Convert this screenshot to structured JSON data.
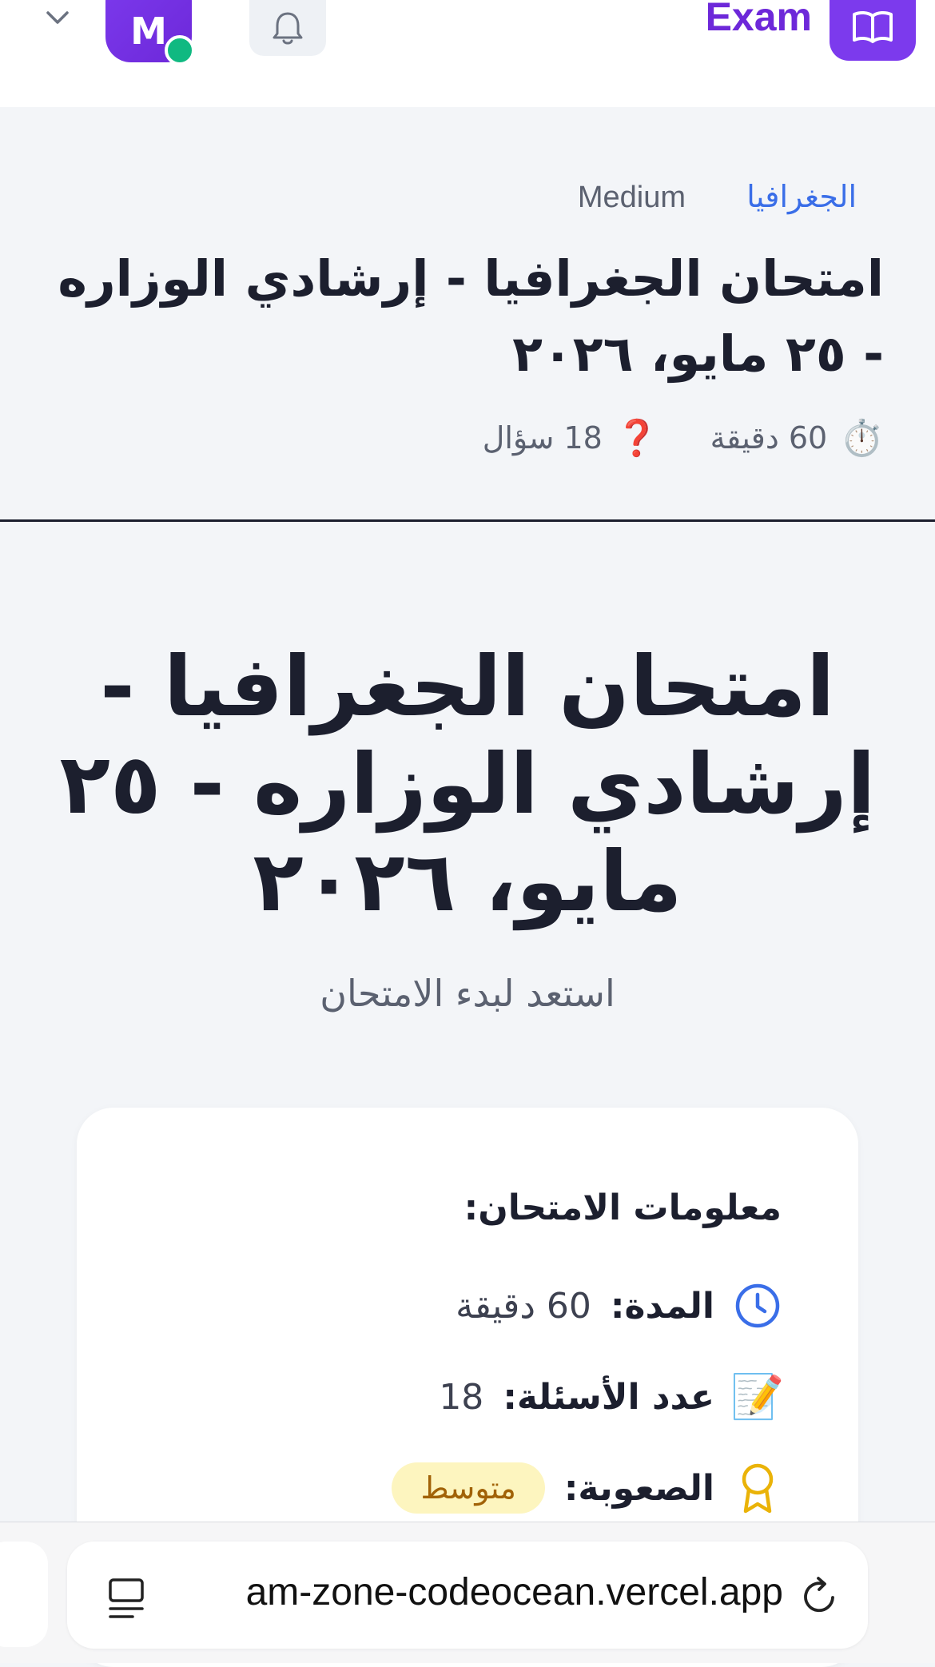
{
  "topbar": {
    "brand": "Exam",
    "avatar_initial": "M",
    "icons": [
      "chevron-down-icon",
      "bell-icon",
      "book-open-icon"
    ]
  },
  "exam_header": {
    "subject": "الجغرافيا",
    "level": "Medium",
    "title": "امتحان الجغرافيا - إرشادي الوزاره - ٢٥ مايو، ٢٠٢٦",
    "duration": "60 دقيقة",
    "questions": "18 سؤال",
    "duration_icon": "⏱️",
    "questions_icon": "❓"
  },
  "hero": {
    "title": "امتحان الجغرافيا - إرشادي الوزاره - ٢٥ مايو، ٢٠٢٦",
    "subtitle": "استعد لبدء الامتحان"
  },
  "info_card": {
    "heading": "معلومات الامتحان:",
    "duration_label": "المدة:",
    "duration_value": "60 دقيقة",
    "questions_label": "عدد الأسئلة:",
    "questions_value": "18",
    "questions_icon": "📝",
    "difficulty_label": "الصعوبة:",
    "difficulty_value": "متوسط"
  },
  "browser": {
    "url": "am-zone-codeocean.vercel.app"
  },
  "colors": {
    "accent": "#7c3aed",
    "link": "#3a6ee8",
    "online": "#10b981",
    "badge_bg": "#fdf5bf",
    "badge_text": "#a16207"
  }
}
